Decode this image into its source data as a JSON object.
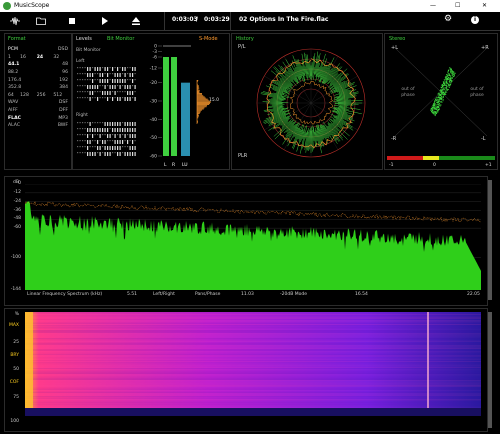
{
  "window": {
    "title": "MusicScope",
    "minimize_glyph": "—",
    "maximize_glyph": "☐",
    "close_glyph": "✕"
  },
  "toolbar": {
    "time_current": "0:03:03",
    "time_separator": "/",
    "time_total": "0:03:29",
    "track": "02 Options In The Fire.flac",
    "icons": [
      "waveform-icon",
      "folder-icon",
      "stop-icon",
      "play-icon",
      "eject-icon",
      "gear-icon",
      "info-icon"
    ]
  },
  "format": {
    "title": "Format",
    "pcm": "PCM",
    "dsd": "DSD",
    "bits": [
      "1",
      "16",
      "24",
      "32"
    ],
    "rates_left": [
      "44.1",
      "88.2",
      "176.4",
      "352.8"
    ],
    "rates_right": [
      "48",
      "96",
      "192",
      "384"
    ],
    "dsd_rates": [
      "64",
      "128",
      "256",
      "512"
    ],
    "containers_left": [
      "WAV",
      "AIFF",
      "FLAC",
      "ALAC"
    ],
    "containers_right": [
      "DSF",
      "DFF",
      "MP3",
      "BWF"
    ],
    "selected_bits": "24",
    "selected_rate": "44.1",
    "selected_container": "FLAC"
  },
  "levels": {
    "title": "Levels",
    "bit_monitor_label": "Bit Monitor",
    "bit_monitor_caption": "Bit Monitor",
    "left_label": "Left",
    "right_label": "Right",
    "scale": [
      "0",
      "-3",
      "-6",
      "-12",
      "-20",
      "-30",
      "-40",
      "-50",
      "-60"
    ],
    "channel_labels": [
      "L",
      "R",
      "LU"
    ],
    "smode_label": "S-Mode",
    "readout": "15.0",
    "left_level_db": -6,
    "right_level_db": -6,
    "lu_level_db": -20
  },
  "history": {
    "title": "History",
    "pl_label": "P/L",
    "plr_label": "PLR"
  },
  "stereo": {
    "title": "Stereo",
    "plus_l": "+L",
    "plus_r": "+R",
    "minus_r": "-R",
    "minus_l": "-L",
    "out_of_phase_left": "out of phase",
    "out_of_phase_right": "out of phase",
    "corr_left": "-1",
    "corr_center": "0",
    "corr_right": "+1"
  },
  "spectrum": {
    "unit_label": "dB",
    "y_ticks": [
      "0",
      "-12",
      "-24",
      "-36",
      "-48",
      "-60",
      "-100",
      "-144"
    ],
    "x_ticks": [
      "5.51",
      "11.03",
      "16.54",
      "22.05"
    ],
    "footer_left": "Linear Frequency Spectrum (kHz)",
    "footer_mode1": "Left/Right",
    "footer_mode2": "Pans/Phase",
    "footer_mode3": "-20dB Mode"
  },
  "spectrogram": {
    "y_ticks": [
      "%",
      "MAX",
      "25",
      "BRY",
      "50",
      "COF",
      "75",
      "100"
    ]
  },
  "colors": {
    "green": "#3fcf3f",
    "orange": "#ff9a2e",
    "lu_blue": "#2a8fb0",
    "spectrum_green": "#2fcf1a"
  }
}
